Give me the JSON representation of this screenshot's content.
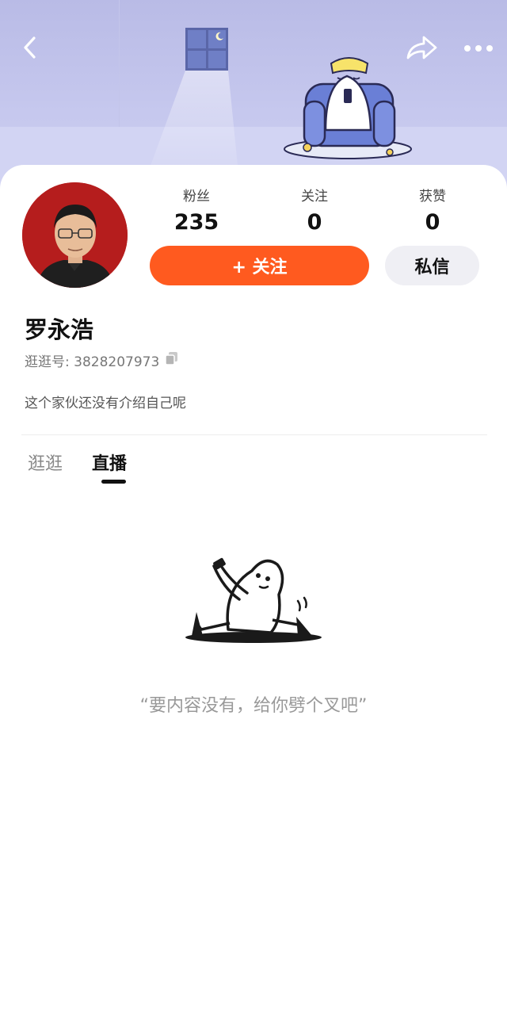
{
  "header": {
    "back_icon": "chevron-left-icon",
    "share_icon": "share-icon",
    "more_icon": "more-dots-icon"
  },
  "profile": {
    "name": "罗永浩",
    "uid_label": "逛逛号: 3828207973",
    "bio": "这个家伙还没有介绍自己呢"
  },
  "stats": [
    {
      "label": "粉丝",
      "value": "235"
    },
    {
      "label": "关注",
      "value": "0"
    },
    {
      "label": "获赞",
      "value": "0"
    }
  ],
  "actions": {
    "follow_label": "+ 关注",
    "message_label": "私信"
  },
  "tabs": [
    {
      "label": "逛逛",
      "active": false
    },
    {
      "label": "直播",
      "active": true
    }
  ],
  "empty_state": {
    "text": "“要内容没有，给你劈个叉吧”"
  },
  "colors": {
    "accent": "#ff5a1f",
    "banner": "#c6c8ee",
    "avatar_bg": "#b51d1d"
  }
}
